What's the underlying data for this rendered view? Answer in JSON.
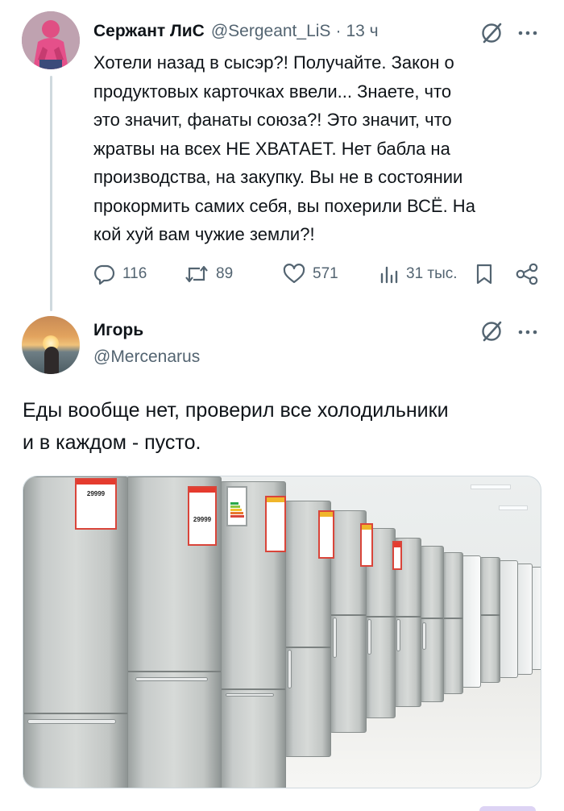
{
  "tweet1": {
    "author_name": "Сержант ЛиС",
    "author_handle": "@Sergeant_LiS",
    "separator": "·",
    "timestamp": "13 ч",
    "text": "Хотели назад в сысэр?! Получайте. Закон о\nпродуктовых карточках ввели... Знаете, что\nэто значит, фанаты союза?! Это значит, что\nжратвы на всех НЕ ХВАТАЕТ. Нет бабла на\nпроизводства, на закупку. Вы не в состоянии\nпрокормить самих себя, вы похерили ВСЁ. На\nкой хуй вам чужие земли?!",
    "actions": {
      "replies": "116",
      "reposts": "89",
      "likes": "571",
      "views": "31 тыс."
    }
  },
  "tweet2": {
    "author_name": "Игорь",
    "author_handle": "@Mercenarus",
    "text": "Еды вообще нет, проверил все холодильники\nи в каждом - пусто."
  },
  "photo": {
    "price_tags": [
      "29999",
      "29999"
    ]
  },
  "colors": {
    "text_primary": "#0f1419",
    "text_secondary": "#536471",
    "thread_line": "#cfd9de",
    "price_tag_red": "#e53b2e"
  },
  "icons": [
    "grok-icon",
    "more-icon",
    "reply-icon",
    "repost-icon",
    "like-icon",
    "views-icon",
    "bookmark-icon",
    "share-icon"
  ]
}
